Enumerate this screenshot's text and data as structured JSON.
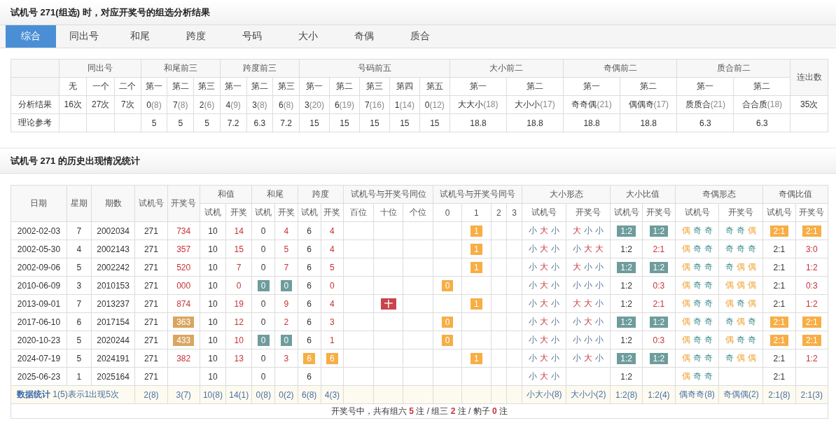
{
  "header": {
    "title": "试机号 271(组选) 时，对应开奖号的组选分析结果"
  },
  "tabs": [
    {
      "label": "综合",
      "selected": true
    },
    {
      "label": "同出号",
      "selected": false
    },
    {
      "label": "和尾",
      "selected": false
    },
    {
      "label": "跨度",
      "selected": false
    },
    {
      "label": "号码",
      "selected": false
    },
    {
      "label": "大小",
      "selected": false
    },
    {
      "label": "奇偶",
      "selected": false
    },
    {
      "label": "质合",
      "selected": false
    }
  ],
  "summary_table": {
    "groups": [
      {
        "label": "同出号",
        "columns": [
          "无",
          "一个",
          "二个"
        ]
      },
      {
        "label": "和尾前三",
        "columns": [
          "第一",
          "第二",
          "第三"
        ]
      },
      {
        "label": "跨度前三",
        "columns": [
          "第一",
          "第二",
          "第三"
        ]
      },
      {
        "label": "号码前五",
        "columns": [
          "第一",
          "第二",
          "第三",
          "第四",
          "第五"
        ]
      },
      {
        "label": "大小前二",
        "columns": [
          "第一",
          "第二"
        ]
      },
      {
        "label": "奇偶前二",
        "columns": [
          "第一",
          "第二"
        ]
      },
      {
        "label": "质合前二",
        "columns": [
          "第一",
          "第二"
        ]
      }
    ],
    "last_column": "连出数",
    "rows": [
      {
        "label": "分析结果",
        "cells": [
          {
            "value": "16次"
          },
          {
            "value": "27次"
          },
          {
            "value": "7次"
          },
          {
            "value": "0",
            "count": "(8)"
          },
          {
            "value": "7",
            "count": "(8)"
          },
          {
            "value": "2",
            "count": "(6)"
          },
          {
            "value": "4",
            "count": "(9)"
          },
          {
            "value": "3",
            "count": "(8)"
          },
          {
            "value": "6",
            "count": "(8)"
          },
          {
            "value": "3",
            "count": "(20)"
          },
          {
            "value": "6",
            "count": "(19)"
          },
          {
            "value": "7",
            "count": "(16)"
          },
          {
            "value": "1",
            "count": "(14)"
          },
          {
            "value": "0",
            "count": "(12)"
          },
          {
            "value": "大大小",
            "count": "(18)"
          },
          {
            "value": "大小小",
            "count": "(17)"
          },
          {
            "value": "奇奇偶",
            "count": "(21)"
          },
          {
            "value": "偶偶奇",
            "count": "(17)"
          },
          {
            "value": "质质合",
            "count": "(21)"
          },
          {
            "value": "合合质",
            "count": "(18)"
          },
          {
            "value": "35次"
          }
        ]
      },
      {
        "label": "理论参考",
        "cells": [
          null,
          null,
          null,
          {
            "value": "5"
          },
          {
            "value": "5"
          },
          {
            "value": "5"
          },
          {
            "value": "7.2"
          },
          {
            "value": "6.3"
          },
          {
            "value": "7.2"
          },
          {
            "value": "15"
          },
          {
            "value": "15"
          },
          {
            "value": "15"
          },
          {
            "value": "15"
          },
          {
            "value": "15"
          },
          {
            "value": "18.8"
          },
          {
            "value": "18.8"
          },
          {
            "value": "18.8"
          },
          {
            "value": "18.8"
          },
          {
            "value": "6.3"
          },
          {
            "value": "6.3"
          },
          null
        ]
      }
    ]
  },
  "history": {
    "title": "试机号 271 的历史出现情况统计",
    "single_columns": [
      "日期",
      "星期",
      "期数",
      "试机号",
      "开奖号"
    ],
    "groups": [
      {
        "label": "和值",
        "columns": [
          "试机",
          "开奖"
        ]
      },
      {
        "label": "和尾",
        "columns": [
          "试机",
          "开奖"
        ]
      },
      {
        "label": "跨度",
        "columns": [
          "试机",
          "开奖"
        ]
      },
      {
        "label": "试机号与开奖号同位",
        "columns": [
          "百位",
          "十位",
          "个位"
        ]
      },
      {
        "label": "试机号与开奖号同号",
        "columns": [
          "0",
          "1",
          "2",
          "3"
        ]
      },
      {
        "label": "大小形态",
        "columns": [
          "试机号",
          "开奖号"
        ]
      },
      {
        "label": "大小比值",
        "columns": [
          "试机号",
          "开奖号"
        ]
      },
      {
        "label": "奇偶形态",
        "columns": [
          "试机号",
          "开奖号"
        ]
      },
      {
        "label": "奇偶比值",
        "columns": [
          "试机号",
          "开奖号"
        ]
      }
    ],
    "rows": [
      [
        "2002-02-03",
        "7",
        "2002034",
        "271",
        {
          "text": "734",
          "kind": "red"
        },
        "10",
        {
          "text": "14",
          "kind": "red"
        },
        "0",
        {
          "text": "4",
          "kind": "red"
        },
        "6",
        {
          "text": "4",
          "kind": "red"
        },
        null,
        null,
        null,
        null,
        {
          "text": "1",
          "kind": "orange-tag"
        },
        null,
        null,
        {
          "parts": [
            {
              "text": "小",
              "kind": "low"
            },
            {
              "text": "大",
              "kind": "high"
            },
            {
              "text": "小",
              "kind": "low"
            }
          ]
        },
        {
          "parts": [
            {
              "text": "大",
              "kind": "high"
            },
            {
              "text": "小",
              "kind": "low"
            },
            {
              "text": "小",
              "kind": "low"
            }
          ]
        },
        {
          "text": "1:2",
          "kind": "teal-tag"
        },
        {
          "text": "1:2",
          "kind": "teal-tag"
        },
        {
          "parts": [
            {
              "text": "偶",
              "kind": "even"
            },
            {
              "text": "奇",
              "kind": "odd"
            },
            {
              "text": "奇",
              "kind": "odd"
            }
          ]
        },
        {
          "parts": [
            {
              "text": "奇",
              "kind": "odd"
            },
            {
              "text": "奇",
              "kind": "odd"
            },
            {
              "text": "偶",
              "kind": "even"
            }
          ]
        },
        {
          "text": "2:1",
          "kind": "orange-tag"
        },
        {
          "text": "2:1",
          "kind": "orange-tag"
        }
      ],
      [
        "2002-05-30",
        "4",
        "2002143",
        "271",
        {
          "text": "357",
          "kind": "red"
        },
        "10",
        {
          "text": "15",
          "kind": "red"
        },
        "0",
        {
          "text": "5",
          "kind": "red"
        },
        "6",
        {
          "text": "4",
          "kind": "red"
        },
        null,
        null,
        null,
        null,
        {
          "text": "1",
          "kind": "orange-tag"
        },
        null,
        null,
        {
          "parts": [
            {
              "text": "小",
              "kind": "low"
            },
            {
              "text": "大",
              "kind": "high"
            },
            {
              "text": "小",
              "kind": "low"
            }
          ]
        },
        {
          "parts": [
            {
              "text": "小",
              "kind": "low"
            },
            {
              "text": "大",
              "kind": "high"
            },
            {
              "text": "大",
              "kind": "high"
            }
          ]
        },
        "1:2",
        {
          "text": "2:1",
          "kind": "red"
        },
        {
          "parts": [
            {
              "text": "偶",
              "kind": "even"
            },
            {
              "text": "奇",
              "kind": "odd"
            },
            {
              "text": "奇",
              "kind": "odd"
            }
          ]
        },
        {
          "parts": [
            {
              "text": "奇",
              "kind": "odd"
            },
            {
              "text": "奇",
              "kind": "odd"
            },
            {
              "text": "奇",
              "kind": "odd"
            }
          ]
        },
        "2:1",
        {
          "text": "3:0",
          "kind": "red"
        }
      ],
      [
        "2002-09-06",
        "5",
        "2002242",
        "271",
        {
          "text": "520",
          "kind": "red"
        },
        "10",
        {
          "text": "7",
          "kind": "red"
        },
        "0",
        {
          "text": "7",
          "kind": "red"
        },
        "6",
        {
          "text": "5",
          "kind": "red"
        },
        null,
        null,
        null,
        null,
        {
          "text": "1",
          "kind": "orange-tag"
        },
        null,
        null,
        {
          "parts": [
            {
              "text": "小",
              "kind": "low"
            },
            {
              "text": "大",
              "kind": "high"
            },
            {
              "text": "小",
              "kind": "low"
            }
          ]
        },
        {
          "parts": [
            {
              "text": "大",
              "kind": "high"
            },
            {
              "text": "小",
              "kind": "low"
            },
            {
              "text": "小",
              "kind": "low"
            }
          ]
        },
        {
          "text": "1:2",
          "kind": "teal-tag"
        },
        {
          "text": "1:2",
          "kind": "teal-tag"
        },
        {
          "parts": [
            {
              "text": "偶",
              "kind": "even"
            },
            {
              "text": "奇",
              "kind": "odd"
            },
            {
              "text": "奇",
              "kind": "odd"
            }
          ]
        },
        {
          "parts": [
            {
              "text": "奇",
              "kind": "odd"
            },
            {
              "text": "偶",
              "kind": "even"
            },
            {
              "text": "偶",
              "kind": "even"
            }
          ]
        },
        "2:1",
        {
          "text": "1:2",
          "kind": "red"
        }
      ],
      [
        "2010-06-09",
        "3",
        "2010153",
        "271",
        {
          "text": "000",
          "kind": "red"
        },
        "10",
        {
          "text": "0",
          "kind": "red"
        },
        {
          "text": "0",
          "kind": "teal-tag"
        },
        {
          "text": "0",
          "kind": "teal-tag"
        },
        "6",
        {
          "text": "0",
          "kind": "red"
        },
        null,
        null,
        null,
        {
          "text": "0",
          "kind": "orange-tag"
        },
        null,
        null,
        null,
        {
          "parts": [
            {
              "text": "小",
              "kind": "low"
            },
            {
              "text": "大",
              "kind": "high"
            },
            {
              "text": "小",
              "kind": "low"
            }
          ]
        },
        {
          "parts": [
            {
              "text": "小",
              "kind": "low"
            },
            {
              "text": "小",
              "kind": "low"
            },
            {
              "text": "小",
              "kind": "low"
            }
          ]
        },
        "1:2",
        {
          "text": "0:3",
          "kind": "red"
        },
        {
          "parts": [
            {
              "text": "偶",
              "kind": "even"
            },
            {
              "text": "奇",
              "kind": "odd"
            },
            {
              "text": "奇",
              "kind": "odd"
            }
          ]
        },
        {
          "parts": [
            {
              "text": "偶",
              "kind": "even"
            },
            {
              "text": "偶",
              "kind": "even"
            },
            {
              "text": "偶",
              "kind": "even"
            }
          ]
        },
        "2:1",
        {
          "text": "0:3",
          "kind": "red"
        }
      ],
      [
        "2013-09-01",
        "7",
        "2013237",
        "271",
        {
          "text": "874",
          "kind": "red"
        },
        "10",
        {
          "text": "19",
          "kind": "red"
        },
        "0",
        {
          "text": "9",
          "kind": "red"
        },
        "6",
        {
          "text": "4",
          "kind": "red"
        },
        null,
        {
          "text": "十",
          "kind": "crimson-tag"
        },
        null,
        null,
        {
          "text": "1",
          "kind": "orange-tag"
        },
        null,
        null,
        {
          "parts": [
            {
              "text": "小",
              "kind": "low"
            },
            {
              "text": "大",
              "kind": "high"
            },
            {
              "text": "小",
              "kind": "low"
            }
          ]
        },
        {
          "parts": [
            {
              "text": "大",
              "kind": "high"
            },
            {
              "text": "大",
              "kind": "high"
            },
            {
              "text": "小",
              "kind": "low"
            }
          ]
        },
        "1:2",
        {
          "text": "2:1",
          "kind": "red"
        },
        {
          "parts": [
            {
              "text": "偶",
              "kind": "even"
            },
            {
              "text": "奇",
              "kind": "odd"
            },
            {
              "text": "奇",
              "kind": "odd"
            }
          ]
        },
        {
          "parts": [
            {
              "text": "偶",
              "kind": "even"
            },
            {
              "text": "奇",
              "kind": "odd"
            },
            {
              "text": "偶",
              "kind": "even"
            }
          ]
        },
        "2:1",
        {
          "text": "1:2",
          "kind": "red"
        }
      ],
      [
        "2017-06-10",
        "6",
        "2017154",
        "271",
        {
          "text": "363",
          "kind": "tan-tag"
        },
        "10",
        {
          "text": "12",
          "kind": "red"
        },
        "0",
        {
          "text": "2",
          "kind": "red"
        },
        "6",
        {
          "text": "3",
          "kind": "red"
        },
        null,
        null,
        null,
        {
          "text": "0",
          "kind": "orange-tag"
        },
        null,
        null,
        null,
        {
          "parts": [
            {
              "text": "小",
              "kind": "low"
            },
            {
              "text": "大",
              "kind": "high"
            },
            {
              "text": "小",
              "kind": "low"
            }
          ]
        },
        {
          "parts": [
            {
              "text": "小",
              "kind": "low"
            },
            {
              "text": "大",
              "kind": "high"
            },
            {
              "text": "小",
              "kind": "low"
            }
          ]
        },
        {
          "text": "1:2",
          "kind": "teal-tag"
        },
        {
          "text": "1:2",
          "kind": "teal-tag"
        },
        {
          "parts": [
            {
              "text": "偶",
              "kind": "even"
            },
            {
              "text": "奇",
              "kind": "odd"
            },
            {
              "text": "奇",
              "kind": "odd"
            }
          ]
        },
        {
          "parts": [
            {
              "text": "奇",
              "kind": "odd"
            },
            {
              "text": "偶",
              "kind": "even"
            },
            {
              "text": "奇",
              "kind": "odd"
            }
          ]
        },
        {
          "text": "2:1",
          "kind": "orange-tag"
        },
        {
          "text": "2:1",
          "kind": "orange-tag"
        }
      ],
      [
        "2020-10-23",
        "5",
        "2020244",
        "271",
        {
          "text": "433",
          "kind": "tan-tag"
        },
        "10",
        {
          "text": "10",
          "kind": "red"
        },
        {
          "text": "0",
          "kind": "teal-tag"
        },
        {
          "text": "0",
          "kind": "teal-tag"
        },
        "6",
        {
          "text": "1",
          "kind": "red"
        },
        null,
        null,
        null,
        {
          "text": "0",
          "kind": "orange-tag"
        },
        null,
        null,
        null,
        {
          "parts": [
            {
              "text": "小",
              "kind": "low"
            },
            {
              "text": "大",
              "kind": "high"
            },
            {
              "text": "小",
              "kind": "low"
            }
          ]
        },
        {
          "parts": [
            {
              "text": "小",
              "kind": "low"
            },
            {
              "text": "小",
              "kind": "low"
            },
            {
              "text": "小",
              "kind": "low"
            }
          ]
        },
        "1:2",
        {
          "text": "0:3",
          "kind": "red"
        },
        {
          "parts": [
            {
              "text": "偶",
              "kind": "even"
            },
            {
              "text": "奇",
              "kind": "odd"
            },
            {
              "text": "奇",
              "kind": "odd"
            }
          ]
        },
        {
          "parts": [
            {
              "text": "偶",
              "kind": "even"
            },
            {
              "text": "奇",
              "kind": "odd"
            },
            {
              "text": "奇",
              "kind": "odd"
            }
          ]
        },
        {
          "text": "2:1",
          "kind": "orange-tag"
        },
        {
          "text": "2:1",
          "kind": "orange-tag"
        }
      ],
      [
        "2024-07-19",
        "5",
        "2024191",
        "271",
        {
          "text": "382",
          "kind": "red"
        },
        "10",
        {
          "text": "13",
          "kind": "red"
        },
        "0",
        {
          "text": "3",
          "kind": "red"
        },
        {
          "text": "6",
          "kind": "orange-tag"
        },
        {
          "text": "6",
          "kind": "orange-tag"
        },
        null,
        null,
        null,
        null,
        {
          "text": "1",
          "kind": "orange-tag"
        },
        null,
        null,
        {
          "parts": [
            {
              "text": "小",
              "kind": "low"
            },
            {
              "text": "大",
              "kind": "high"
            },
            {
              "text": "小",
              "kind": "low"
            }
          ]
        },
        {
          "parts": [
            {
              "text": "小",
              "kind": "low"
            },
            {
              "text": "大",
              "kind": "high"
            },
            {
              "text": "小",
              "kind": "low"
            }
          ]
        },
        {
          "text": "1:2",
          "kind": "teal-tag"
        },
        {
          "text": "1:2",
          "kind": "teal-tag"
        },
        {
          "parts": [
            {
              "text": "偶",
              "kind": "even"
            },
            {
              "text": "奇",
              "kind": "odd"
            },
            {
              "text": "奇",
              "kind": "odd"
            }
          ]
        },
        {
          "parts": [
            {
              "text": "奇",
              "kind": "odd"
            },
            {
              "text": "偶",
              "kind": "even"
            },
            {
              "text": "偶",
              "kind": "even"
            }
          ]
        },
        "2:1",
        {
          "text": "1:2",
          "kind": "red"
        }
      ],
      [
        "2025-06-23",
        "1",
        "2025164",
        "271",
        null,
        "10",
        null,
        "0",
        null,
        "6",
        null,
        null,
        null,
        null,
        null,
        null,
        null,
        null,
        {
          "parts": [
            {
              "text": "小",
              "kind": "low"
            },
            {
              "text": "大",
              "kind": "high"
            },
            {
              "text": "小",
              "kind": "low"
            }
          ]
        },
        null,
        "1:2",
        null,
        {
          "parts": [
            {
              "text": "偶",
              "kind": "even"
            },
            {
              "text": "奇",
              "kind": "odd"
            },
            {
              "text": "奇",
              "kind": "odd"
            }
          ]
        },
        null,
        "2:1",
        null
      ]
    ],
    "stats": {
      "label": "**数据统计** 1(5)表示1出现5次",
      "cells": [
        "2(8)",
        "3(7)",
        "10(8)",
        "14(1)",
        "0(8)",
        "0(2)",
        "6(8)",
        "4(3)",
        null,
        null,
        null,
        null,
        null,
        null,
        null,
        "小大小(8)",
        "大小小(2)",
        "1:2(8)",
        "1:2(4)",
        "偶奇奇(8)",
        "奇偶偶(2)",
        "2:1(8)",
        "2:1(3)"
      ]
    },
    "summary": "开奖号中，共有组六 **5** 注 / 组三 **2** 注 / 豹子 **0** 注"
  }
}
